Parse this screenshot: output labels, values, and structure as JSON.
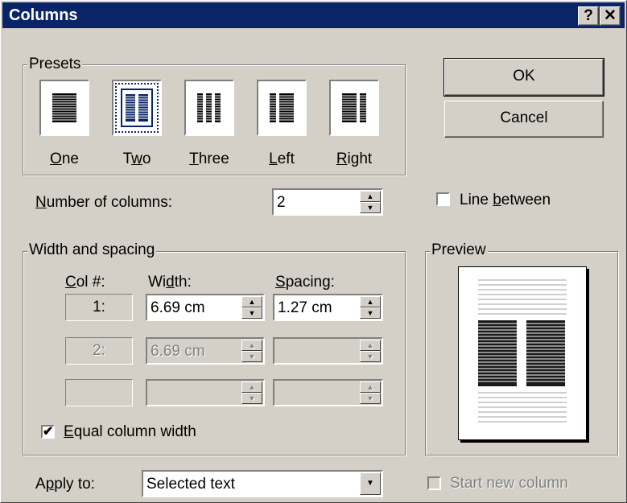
{
  "window": {
    "title": "Columns",
    "help_button": "?",
    "close_button": "✕"
  },
  "presets": {
    "group_label": "Presets",
    "items": [
      {
        "label": "One",
        "accel": "O",
        "rest": "ne",
        "pre": ""
      },
      {
        "label": "Two",
        "accel": "w",
        "rest": "o",
        "pre": "T"
      },
      {
        "label": "Three",
        "accel": "T",
        "rest": "hree",
        "pre": ""
      },
      {
        "label": "Left",
        "accel": "L",
        "rest": "eft",
        "pre": ""
      },
      {
        "label": "Right",
        "accel": "R",
        "rest": "ight",
        "pre": ""
      }
    ],
    "selected": "Two"
  },
  "buttons": {
    "ok": "OK",
    "cancel": "Cancel"
  },
  "number_of_columns": {
    "label_accel": "N",
    "label_rest": "umber of columns:",
    "value": "2"
  },
  "line_between": {
    "label_pre": "Line ",
    "label_accel": "b",
    "label_rest": "etween",
    "checked": false
  },
  "width_spacing": {
    "group_label": "Width and spacing",
    "col_header_accel": "C",
    "col_header_rest": "ol #:",
    "width_header_pre": "Wi",
    "width_header_accel": "d",
    "width_header_rest": "th:",
    "spacing_header_accel": "S",
    "spacing_header_rest": "pacing:",
    "rows": [
      {
        "col": "1:",
        "width": "6.69 cm",
        "spacing": "1.27 cm",
        "enabled": true
      },
      {
        "col": "2:",
        "width": "6.69 cm",
        "spacing": "",
        "enabled": false
      },
      {
        "col": "",
        "width": "",
        "spacing": "",
        "enabled": false
      }
    ]
  },
  "equal_column_width": {
    "label_accel": "E",
    "label_rest": "qual column width",
    "checked": true,
    "check_mark": "✔"
  },
  "preview": {
    "group_label": "Preview"
  },
  "apply_to": {
    "label_pre": "A",
    "label_accel": "p",
    "label_rest": "ply to:",
    "value": "Selected text",
    "arrow": "▼"
  },
  "start_new_column": {
    "label": "Start new column",
    "checked": false,
    "enabled": false
  },
  "spinner": {
    "up": "▲",
    "down": "▼"
  }
}
